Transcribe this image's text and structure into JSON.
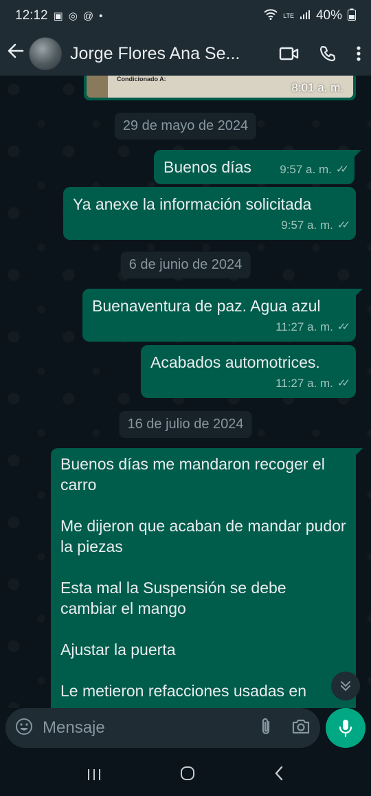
{
  "status_bar": {
    "time": "12:12",
    "network_label": "LTE",
    "battery": "40%"
  },
  "header": {
    "contact_name": "Jorge Flores Ana Se...",
    "icons": [
      "back-arrow-icon",
      "video-call-icon",
      "voice-call-icon",
      "more-options-icon"
    ]
  },
  "image_message": {
    "caption_fragment": "Condicionado A:",
    "time": "8:01 a. m."
  },
  "dates": {
    "d1": "29 de mayo de 2024",
    "d2": "6 de junio de 2024",
    "d3": "16 de julio de 2024"
  },
  "messages": [
    {
      "text": "Buenos días",
      "time": "9:57 a. m."
    },
    {
      "text": "Ya anexe la información solicitada",
      "time": "9:57 a. m."
    },
    {
      "text": "Buenaventura de paz. Agua azul",
      "time": "11:27 a. m."
    },
    {
      "text": "Acabados automotrices.",
      "time": "11:27 a. m."
    }
  ],
  "long_message": {
    "p1": "Buenos días me mandaron recoger el carro",
    "p2": "Me dijeron que acaban de mandar pudor la piezas",
    "p3": "Esta mal la Suspensión se debe cambiar el mango",
    "p4": "Ajustar la puerta",
    "p5": "Le metieron refacciones usadas en"
  },
  "composer": {
    "placeholder": "Mensaje"
  },
  "colors": {
    "outgoing_bubble": "#005c4b",
    "background": "#0b141a",
    "bar": "#1f2c34",
    "accent": "#00a884"
  }
}
